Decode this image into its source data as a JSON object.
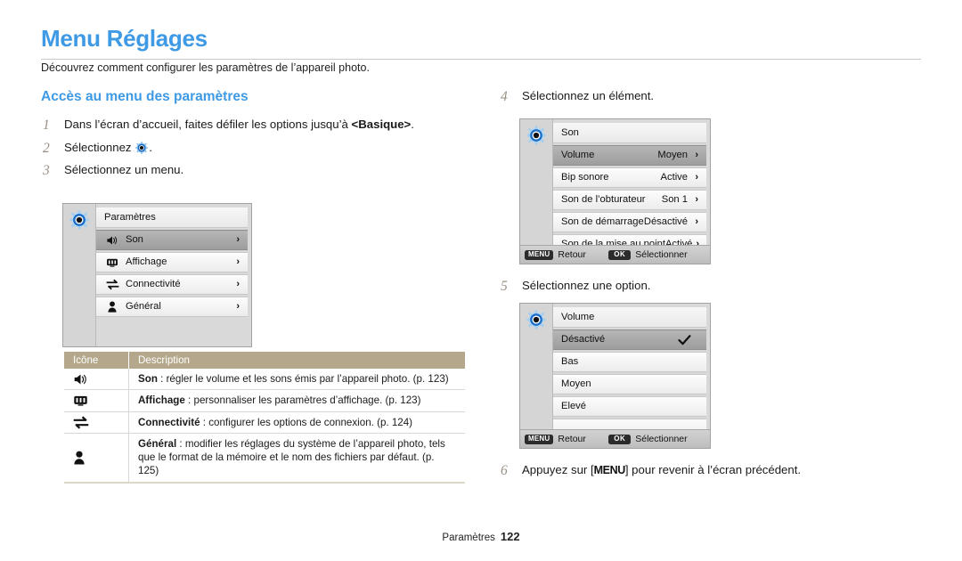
{
  "document": {
    "title": "Menu Réglages",
    "subtitle": "Découvrez comment configurer les paramètres de l’appareil photo.",
    "footer_label": "Paramètres",
    "footer_page": "122"
  },
  "section": {
    "heading": "Accès au menu des paramètres"
  },
  "steps": {
    "s1": {
      "num": "1",
      "text_before": "Dans l’écran d’accueil, faites défiler les options jusqu’à ",
      "bold": "<Basique>",
      "text_after": "."
    },
    "s2": {
      "num": "2",
      "text_before": "Sélectionnez ",
      "text_after": "."
    },
    "s3": {
      "num": "3",
      "text": "Sélectionnez un menu."
    },
    "s4": {
      "num": "4",
      "text": "Sélectionnez un élément."
    },
    "s5": {
      "num": "5",
      "text": "Sélectionnez une option."
    },
    "s6": {
      "num": "6",
      "text_before": "Appuyez sur [",
      "key": "MENU",
      "text_after": "] pour revenir à l’écran précédent."
    }
  },
  "settings_screen": {
    "title": "Paramètres",
    "rows": [
      {
        "icon": "speaker-icon",
        "label": "Son",
        "chevron": "›",
        "selected": true
      },
      {
        "icon": "display-icon",
        "label": "Affichage",
        "chevron": "›",
        "selected": false
      },
      {
        "icon": "connectivity-icon",
        "label": "Connectivité",
        "chevron": "›",
        "selected": false
      },
      {
        "icon": "person-icon",
        "label": "Général",
        "chevron": "›",
        "selected": false
      }
    ]
  },
  "sound_screen": {
    "title": "Son",
    "rows": [
      {
        "label": "Volume",
        "value": "Moyen",
        "chevron": "›",
        "selected": true
      },
      {
        "label": "Bip sonore",
        "value": "Active",
        "chevron": "›",
        "selected": false
      },
      {
        "label": "Son de l’obturateur",
        "value": "Son 1",
        "chevron": "›",
        "selected": false
      },
      {
        "label": "Son de démarrage",
        "value": "Désactivé",
        "chevron": "›",
        "selected": false
      },
      {
        "label": "Son de la mise au point",
        "value": "Activé",
        "chevron": "›",
        "selected": false
      }
    ],
    "bar": {
      "menu_badge": "MENU",
      "menu_label": "Retour",
      "ok_badge": "OK",
      "ok_label": "Sélectionner"
    }
  },
  "volume_screen": {
    "title": "Volume",
    "rows": [
      {
        "label": "Désactivé",
        "selected": true,
        "checked": true
      },
      {
        "label": "Bas",
        "selected": false,
        "checked": false
      },
      {
        "label": "Moyen",
        "selected": false,
        "checked": false
      },
      {
        "label": "Elevé",
        "selected": false,
        "checked": false
      }
    ],
    "bar": {
      "menu_badge": "MENU",
      "menu_label": "Retour",
      "ok_badge": "OK",
      "ok_label": "Sélectionner"
    }
  },
  "icon_table": {
    "headers": {
      "icon": "Icône",
      "description": "Description"
    },
    "rows": [
      {
        "icon": "speaker-icon",
        "term": "Son",
        "desc": " : régler le volume et les sons émis par l’appareil photo. (p. 123)"
      },
      {
        "icon": "display-icon",
        "term": "Affichage",
        "desc": " : personnaliser les paramètres d’affichage. (p. 123)"
      },
      {
        "icon": "connectivity-icon",
        "term": "Connectivité",
        "desc": " : configurer les options de connexion. (p. 124)"
      },
      {
        "icon": "person-icon",
        "term": "Général",
        "desc": " : modifier les réglages du système de l’appareil photo, tels que le format de la mémoire et le nom des fichiers par défaut. (p. 125)"
      }
    ]
  },
  "colors": {
    "accent_blue": "#3f9ae5",
    "table_header": "#b4a78b",
    "step_number": "#9a8f83"
  }
}
